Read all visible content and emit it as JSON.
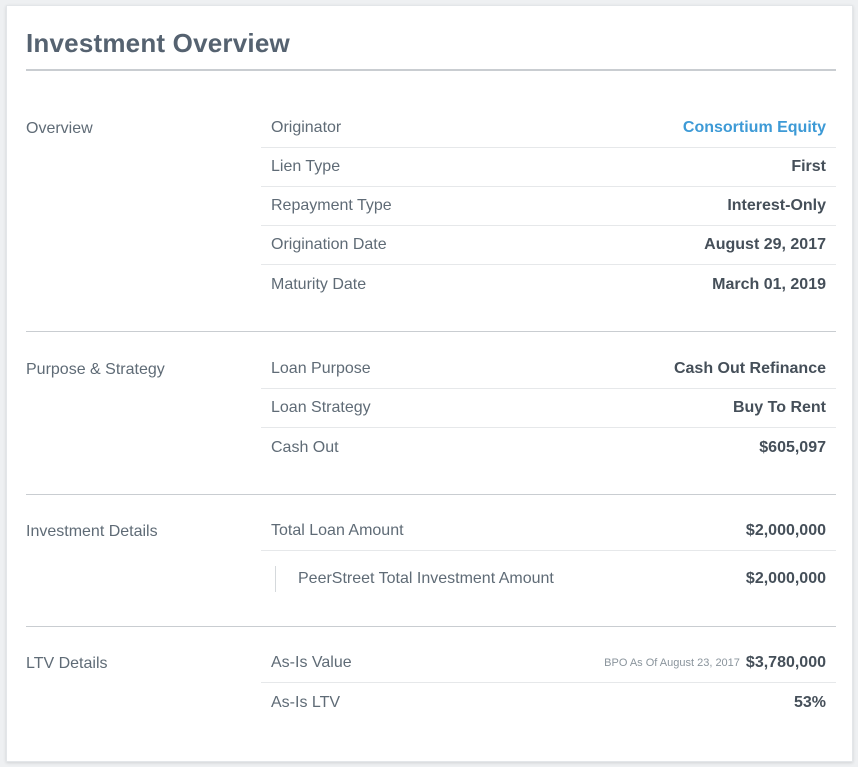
{
  "title": "Investment Overview",
  "sections": {
    "overview": {
      "label": "Overview",
      "rows": [
        {
          "label": "Originator",
          "value": "Consortium Equity"
        },
        {
          "label": "Lien Type",
          "value": "First"
        },
        {
          "label": "Repayment Type",
          "value": "Interest-Only"
        },
        {
          "label": "Origination Date",
          "value": "August 29, 2017"
        },
        {
          "label": "Maturity Date",
          "value": "March 01, 2019"
        }
      ]
    },
    "purpose": {
      "label": "Purpose & Strategy",
      "rows": [
        {
          "label": "Loan Purpose",
          "value": "Cash Out Refinance"
        },
        {
          "label": "Loan Strategy",
          "value": "Buy To Rent"
        },
        {
          "label": "Cash Out",
          "value": "$605,097"
        }
      ]
    },
    "investment": {
      "label": "Investment Details",
      "rows": [
        {
          "label": "Total Loan Amount",
          "value": "$2,000,000"
        },
        {
          "label": "PeerStreet Total Investment Amount",
          "value": "$2,000,000"
        }
      ]
    },
    "ltv": {
      "label": "LTV Details",
      "rows": [
        {
          "label": "As-Is Value",
          "note": "BPO As Of August 23, 2017",
          "value": "$3,780,000"
        },
        {
          "label": "As-Is LTV",
          "value": "53%"
        }
      ]
    }
  },
  "colors": {
    "link": "#3d9ad6",
    "text": "#454f59",
    "muted": "#5f6b76",
    "rule": "#c9cdd1"
  }
}
